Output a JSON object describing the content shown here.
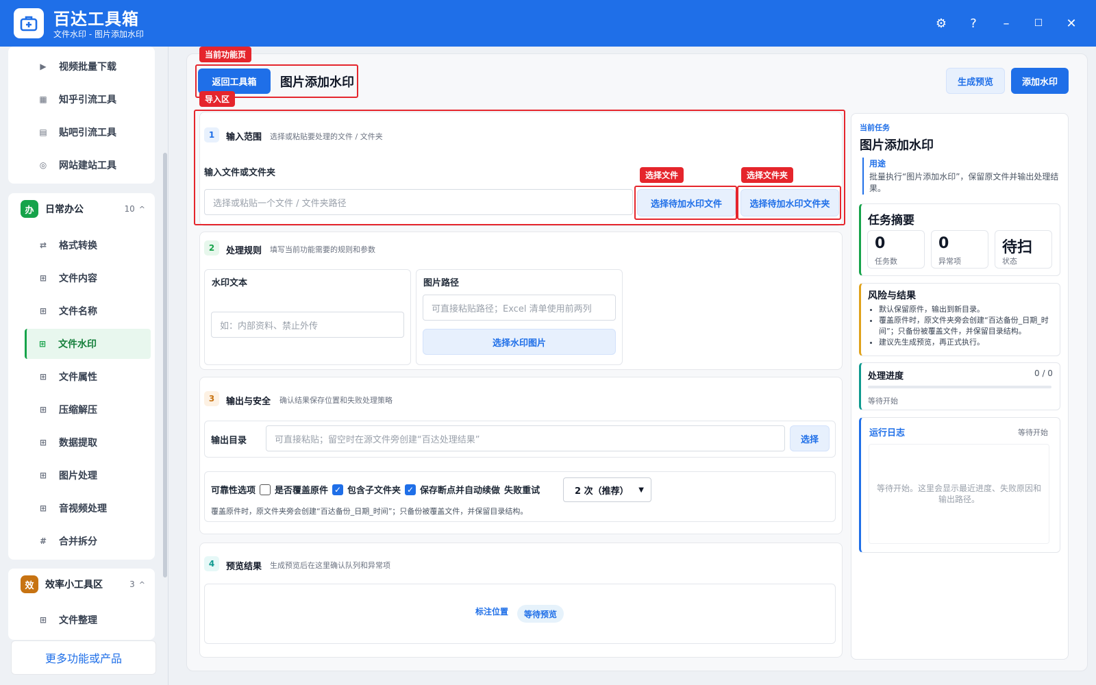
{
  "app": {
    "title": "百达工具箱",
    "subtitle": "文件水印 - 图片添加水印"
  },
  "window_controls": {
    "settings": "⚙",
    "help": "?",
    "minimize": "–",
    "maximize": "☐",
    "close": "✕"
  },
  "sidebar": {
    "top_items": [
      {
        "label": "视频批量下载",
        "icon": "video-icon"
      },
      {
        "label": "知乎引流工具",
        "icon": "zhihu-icon"
      },
      {
        "label": "贴吧引流工具",
        "icon": "tieba-icon"
      },
      {
        "label": "网站建站工具",
        "icon": "globe-icon"
      }
    ],
    "group_daily": {
      "badge": "办",
      "title": "日常办公",
      "count": "10",
      "caret": "^"
    },
    "daily_items": [
      {
        "label": "格式转换",
        "icon": "swap-icon"
      },
      {
        "label": "文件内容",
        "icon": "grid-icon"
      },
      {
        "label": "文件名称",
        "icon": "grid-icon"
      },
      {
        "label": "文件水印",
        "icon": "grid-icon"
      },
      {
        "label": "文件属性",
        "icon": "grid-icon"
      },
      {
        "label": "压缩解压",
        "icon": "grid-icon"
      },
      {
        "label": "数据提取",
        "icon": "grid-icon"
      },
      {
        "label": "图片处理",
        "icon": "grid-icon"
      },
      {
        "label": "音视频处理",
        "icon": "grid-icon"
      },
      {
        "label": "合并拆分",
        "icon": "hash-icon"
      }
    ],
    "group_efficiency": {
      "badge": "效",
      "title": "效率小工具区",
      "count": "3",
      "caret": "^"
    },
    "efficiency_items": [
      {
        "label": "文件整理",
        "icon": "grid-icon"
      }
    ],
    "more_button": "更多功能或产品"
  },
  "header": {
    "back_button": "返回工具箱",
    "page_title": "图片添加水印",
    "preview_button": "生成预览",
    "add_button": "添加水印"
  },
  "annotations": {
    "current_page": "当前功能页",
    "import_area": "导入区",
    "select_file": "选择文件",
    "select_folder": "选择文件夹"
  },
  "step1": {
    "num": "1",
    "title": "输入范围",
    "desc": "选择或粘贴要处理的文件 / 文件夹",
    "field_label": "输入文件或文件夹",
    "placeholder": "选择或粘贴一个文件 / 文件夹路径",
    "select_file_btn": "选择待加水印文件",
    "select_folder_btn": "选择待加水印文件夹"
  },
  "step2": {
    "num": "2",
    "title": "处理规则",
    "desc": "填写当前功能需要的规则和参数",
    "watermark_text_label": "水印文本",
    "watermark_text_placeholder": "如：内部资料、禁止外传",
    "image_path_label": "图片路径",
    "image_path_placeholder": "可直接粘贴路径；Excel 清单使用前两列",
    "select_image_btn": "选择水印图片"
  },
  "step3": {
    "num": "3",
    "title": "输出与安全",
    "desc": "确认结果保存位置和失败处理策略",
    "output_label": "输出目录",
    "output_placeholder": "可直接粘贴；留空时在源文件旁创建“百达处理结果”",
    "choose_btn": "选择",
    "reliability_label": "可靠性选项",
    "opt_overwrite": "是否覆盖原件",
    "opt_subfolders": "包含子文件夹",
    "opt_resume": "保存断点并自动续做",
    "retry_label": "失败重试",
    "retry_value": "2 次（推荐）",
    "note": "覆盖原件时，原文件夹旁会创建“百达备份_日期_时间”；只备份被覆盖文件，并保留目录结构。"
  },
  "step4": {
    "num": "4",
    "title": "预览结果",
    "desc": "生成预览后在这里确认队列和异常项",
    "mark_position": "标注位置",
    "status_chip": "等待预览"
  },
  "right_panel": {
    "current_task_label": "当前任务",
    "task_title": "图片添加水印",
    "purpose_label": "用途",
    "purpose_text": "批量执行“图片添加水印”，保留原文件并输出处理结果。",
    "summary_title": "任务摘要",
    "stats": [
      {
        "value": "0",
        "key": "任务数"
      },
      {
        "value": "0",
        "key": "异常项"
      },
      {
        "value": "待扫",
        "key": "状态"
      }
    ],
    "risk_title": "风险与结果",
    "risk_items": [
      "默认保留原件，输出到新目录。",
      "覆盖原件时，原文件夹旁会创建“百达备份_日期_时间”；只备份被覆盖文件，并保留目录结构。",
      "建议先生成预览，再正式执行。"
    ],
    "progress_title": "处理进度",
    "progress_count": "0 / 0",
    "progress_fraction": 0,
    "progress_status": "等待开始",
    "log_title": "运行日志",
    "log_status": "等待开始",
    "log_placeholder": "等待开始。这里会显示最近进度、失败原因和输出路径。"
  }
}
